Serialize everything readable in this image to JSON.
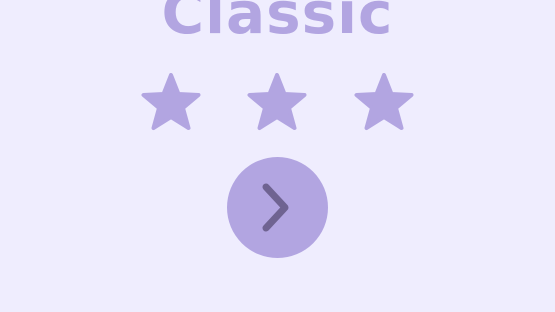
{
  "level": {
    "title": "Classic",
    "rating": {
      "earned": 3,
      "total": 3
    }
  },
  "stars": [
    {
      "icon": "star-icon",
      "filled": true
    },
    {
      "icon": "star-icon",
      "filled": true
    },
    {
      "icon": "star-icon",
      "filled": true
    }
  ],
  "next_button": {
    "icon": "chevron-right-icon"
  },
  "colors": {
    "background": "#efedfe",
    "accent": "#b2a5e1",
    "chevron": "#6f6391"
  }
}
